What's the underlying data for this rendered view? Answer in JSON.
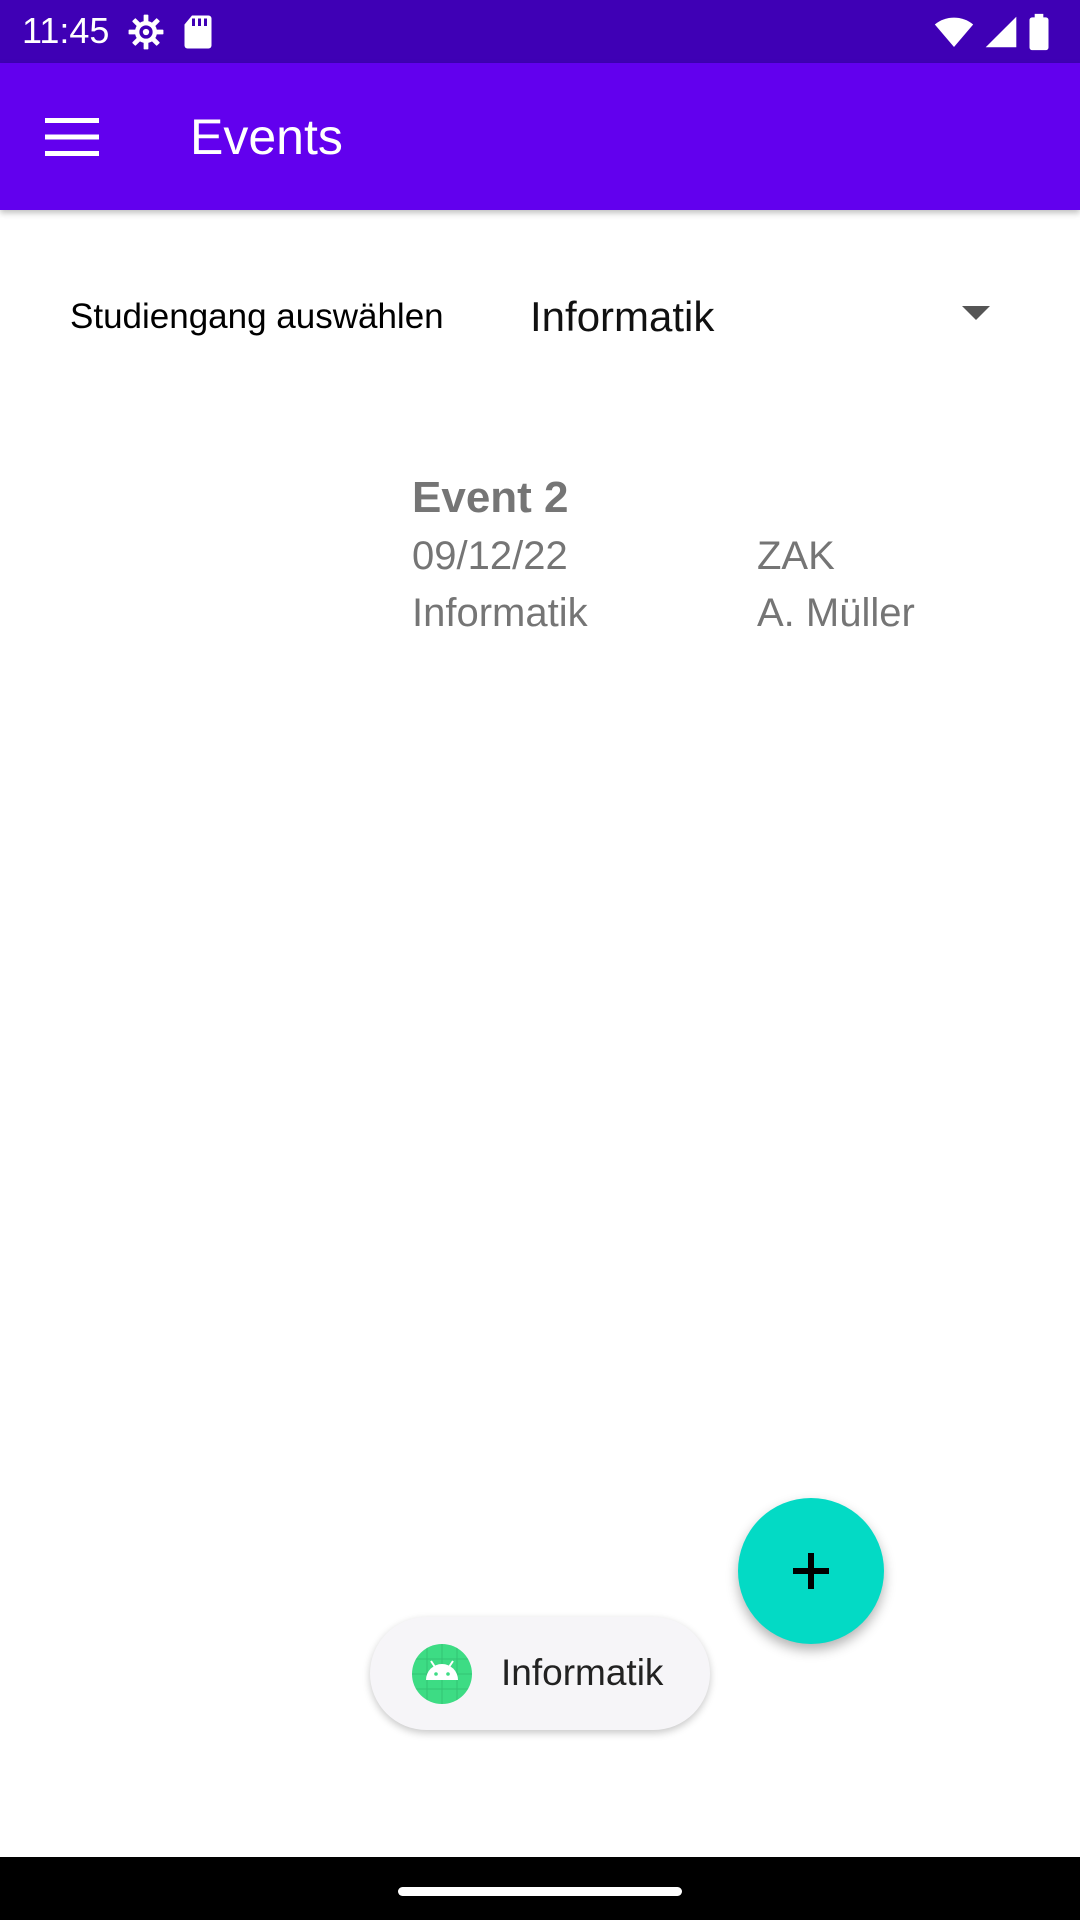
{
  "status_bar": {
    "time": "11:45",
    "left_icons": [
      "settings-gear-icon",
      "sd-card-icon"
    ],
    "right_icons": [
      "wifi-icon",
      "cellular-signal-icon",
      "battery-icon"
    ],
    "background": "#3f00b5"
  },
  "app_bar": {
    "title": "Events",
    "menu_icon": "hamburger-menu-icon",
    "background": "#6200ee"
  },
  "course_selector": {
    "label": "Studiengang auswählen",
    "selected": "Informatik",
    "dropdown_icon": "dropdown-arrow-icon"
  },
  "events": [
    {
      "title": "Event 2",
      "date": "09/12/22",
      "location": "ZAK",
      "course": "Informatik",
      "lecturer": "A. Müller"
    }
  ],
  "fab": {
    "icon": "plus-icon",
    "background": "#03dac5"
  },
  "toast": {
    "icon": "android-robot-icon",
    "text": "Informatik"
  },
  "nav_bar": {
    "home_indicator": "home-indicator"
  }
}
